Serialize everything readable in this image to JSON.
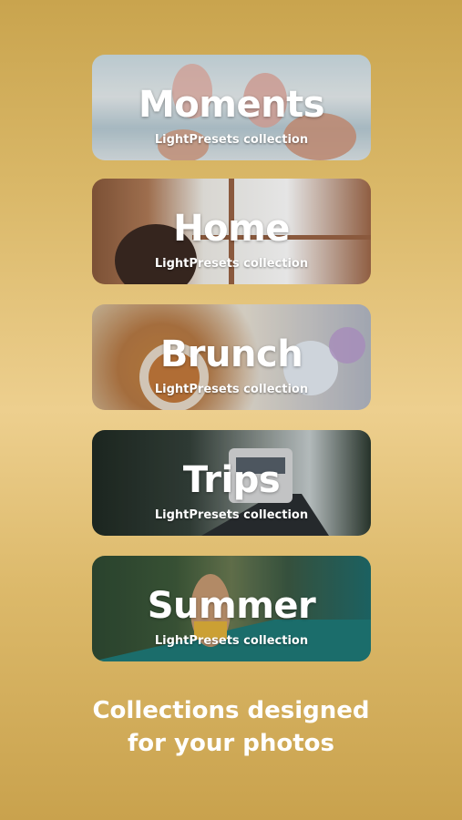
{
  "cards": [
    {
      "title": "Moments",
      "subtitle": "LightPresets collection"
    },
    {
      "title": "Home",
      "subtitle": "LightPresets collection"
    },
    {
      "title": "Brunch",
      "subtitle": "LightPresets collection"
    },
    {
      "title": "Trips",
      "subtitle": "LightPresets collection"
    },
    {
      "title": "Summer",
      "subtitle": "LightPresets collection"
    }
  ],
  "tagline": {
    "line1": "Collections designed",
    "line2": "for your photos"
  },
  "colors": {
    "background_top": "#c9a44e",
    "background_mid": "#edcf8e",
    "text": "#ffffff"
  }
}
